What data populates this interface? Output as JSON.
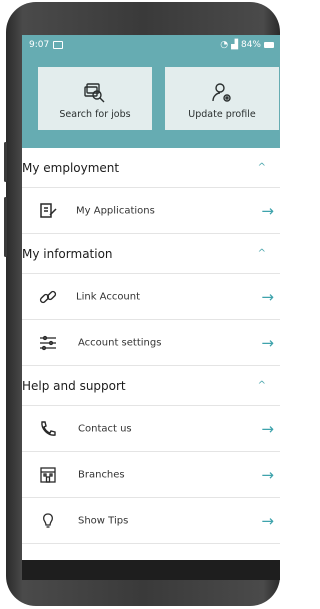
{
  "status": {
    "time": "9:07",
    "battery": "84%"
  },
  "tiles": {
    "search_jobs": "Search for jobs",
    "update_profile": "Update profile"
  },
  "sections": [
    {
      "title": "My employment",
      "items": [
        {
          "label": "My Applications",
          "icon": "document-pen-icon"
        }
      ]
    },
    {
      "title": "My information",
      "items": [
        {
          "label": "Link Account",
          "icon": "link-icon"
        },
        {
          "label": "Account settings",
          "icon": "sliders-icon"
        }
      ]
    },
    {
      "title": "Help and support",
      "items": [
        {
          "label": "Contact us",
          "icon": "phone-icon"
        },
        {
          "label": "Branches",
          "icon": "building-icon"
        },
        {
          "label": "Show Tips",
          "icon": "lightbulb-icon"
        }
      ]
    }
  ],
  "colors": {
    "header": "#66acb2",
    "tile": "#e3eded",
    "accent": "#3ea3ac"
  }
}
